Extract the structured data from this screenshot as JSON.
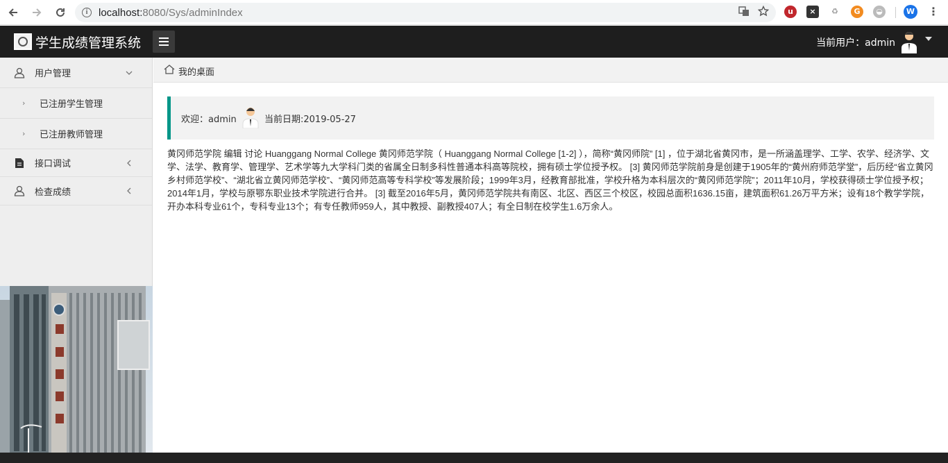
{
  "browser": {
    "url_host": "localhost:",
    "url_port_path": "8080/Sys/adminIndex",
    "extensions": [
      "ublock-icon",
      "x-extension-icon",
      "recycle-extension-icon",
      "chrome-extension-icon",
      "shield-extension-icon"
    ],
    "profile_initial": "W"
  },
  "header": {
    "title": "学生成绩管理系统",
    "current_user_label": "当前用户：admin"
  },
  "sidebar": {
    "items": [
      {
        "label": "用户管理",
        "icon": "user-icon",
        "expanded": true
      },
      {
        "label": "接口调试",
        "icon": "document-icon",
        "expanded": false
      },
      {
        "label": "检查成绩",
        "icon": "user-icon",
        "expanded": false
      }
    ],
    "sub_items": [
      {
        "label": "已注册学生管理"
      },
      {
        "label": "已注册教师管理"
      }
    ]
  },
  "breadcrumb": {
    "label": "我的桌面"
  },
  "welcome": {
    "greeting": "欢迎：admin",
    "date": "当前日期:2019-05-27"
  },
  "intro_text": "黄冈师范学院 编辑 讨论 Huanggang Normal College 黄冈师范学院（ Huanggang Normal College [1-2] ），简称“黄冈师院” [1] ，位于湖北省黄冈市，是一所涵盖理学、工学、农学、经济学、文学、法学、教育学、管理学、艺术学等九大学科门类的省属全日制多科性普通本科高等院校，拥有硕士学位授予权。 [3] 黄冈师范学院前身是创建于1905年的“黄州府师范学堂”，后历经“省立黄冈乡村师范学校”、“湖北省立黄冈师范学校”、“黄冈师范高等专科学校”等发展阶段；1999年3月，经教育部批准，学校升格为本科层次的“黄冈师范学院”；2011年10月，学校获得硕士学位授予权；2014年1月，学校与原鄂东职业技术学院进行合并。 [3] 截至2016年5月，黄冈师范学院共有南区、北区、西区三个校区，校园总面积1636.15亩，建筑面积61.26万平方米；设有18个教学学院，开办本科专业61个，专科专业13个；有专任教师959人，其中教授、副教授407人；有全日制在校学生1.6万余人。",
  "colors": {
    "accent": "#009688",
    "header_bg": "#1e1e1e",
    "sidebar_bg": "#eeeeee"
  }
}
